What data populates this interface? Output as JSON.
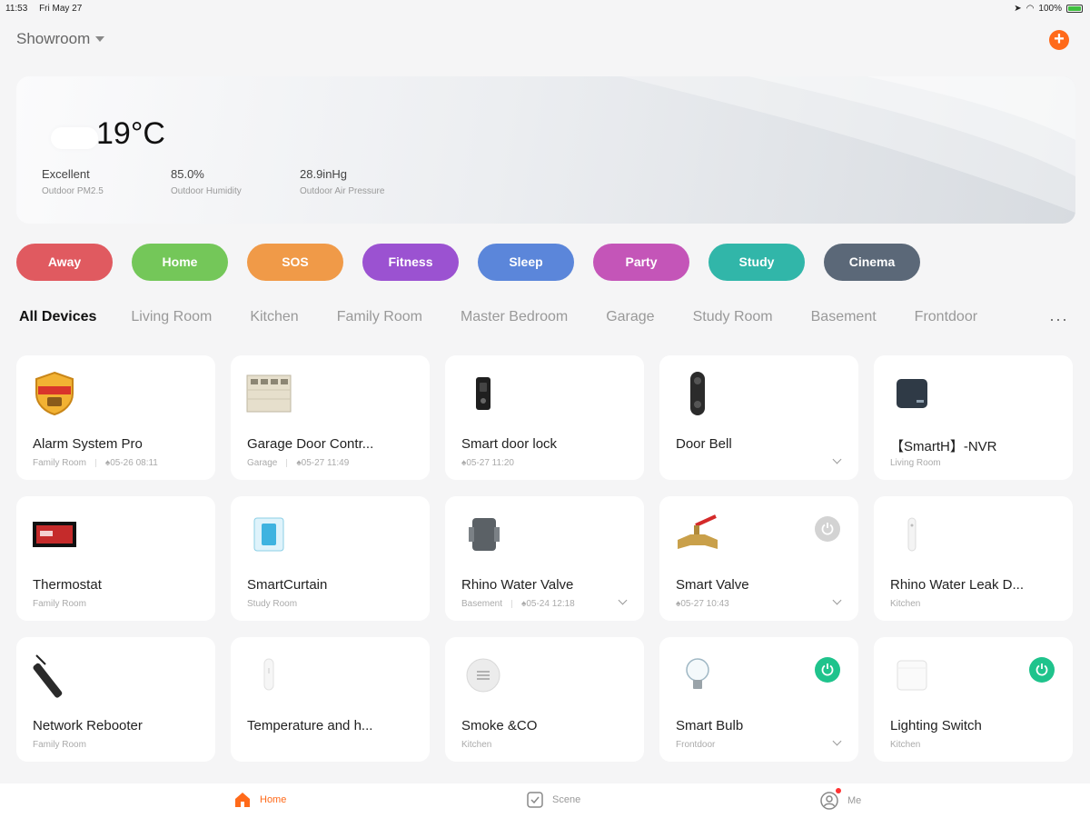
{
  "status_bar": {
    "time": "11:53",
    "date": "Fri May 27",
    "battery": "100%"
  },
  "header": {
    "home_name": "Showroom"
  },
  "weather": {
    "temperature": "19°C",
    "stats": [
      {
        "value": "Excellent",
        "label": "Outdoor PM2.5"
      },
      {
        "value": "85.0%",
        "label": "Outdoor Humidity"
      },
      {
        "value": "28.9inHg",
        "label": "Outdoor Air Pressure"
      }
    ]
  },
  "scenes": [
    {
      "label": "Away",
      "color": "#e05a60"
    },
    {
      "label": "Home",
      "color": "#74c759"
    },
    {
      "label": "SOS",
      "color": "#f09a48"
    },
    {
      "label": "Fitness",
      "color": "#9b52d1"
    },
    {
      "label": "Sleep",
      "color": "#5b86da"
    },
    {
      "label": "Party",
      "color": "#c455b8"
    },
    {
      "label": "Study",
      "color": "#31b6a9"
    },
    {
      "label": "Cinema",
      "color": "#5b6878"
    }
  ],
  "rooms": [
    "All Devices",
    "Living Room",
    "Kitchen",
    "Family Room",
    "Master Bedroom",
    "Garage",
    "Study Room",
    "Basement",
    "Frontdoor"
  ],
  "devices": [
    {
      "name": "Alarm System Pro",
      "room": "Family Room",
      "time": "05-26 08:11",
      "icon": "alarm-system-icon"
    },
    {
      "name": "Garage Door Contr...",
      "room": "Garage",
      "time": "05-27 11:49",
      "icon": "garage-door-icon"
    },
    {
      "name": "Smart door lock",
      "room": "",
      "time": "05-27 11:20",
      "icon": "door-lock-icon"
    },
    {
      "name": "Door Bell",
      "room": "",
      "time": "",
      "icon": "doorbell-icon"
    },
    {
      "name": "【SmartH】-NVR",
      "room": "Living Room",
      "time": "",
      "icon": "nvr-icon"
    },
    {
      "name": "Thermostat",
      "room": "Family Room",
      "time": "",
      "icon": "thermostat-icon"
    },
    {
      "name": "SmartCurtain",
      "room": "Study Room",
      "time": "",
      "icon": "curtain-icon"
    },
    {
      "name": "Rhino Water Valve",
      "room": "Basement",
      "time": "05-24 12:18",
      "icon": "water-valve-icon"
    },
    {
      "name": "Smart Valve",
      "room": "",
      "time": "05-27 10:43",
      "icon": "valve-icon"
    },
    {
      "name": "Rhino Water Leak D...",
      "room": "Kitchen",
      "time": "",
      "icon": "leak-sensor-icon"
    },
    {
      "name": "Network Rebooter",
      "room": "Family Room",
      "time": "",
      "icon": "power-strip-icon"
    },
    {
      "name": "Temperature and h...",
      "room": "",
      "time": "",
      "icon": "temp-sensor-icon"
    },
    {
      "name": "Smoke &CO",
      "room": "Kitchen",
      "time": "",
      "icon": "smoke-detector-icon"
    },
    {
      "name": "Smart Bulb",
      "room": "Frontdoor",
      "time": "",
      "icon": "bulb-icon"
    },
    {
      "name": "Lighting Switch",
      "room": "Kitchen",
      "time": "",
      "icon": "light-switch-icon"
    }
  ],
  "bottom_nav": [
    {
      "label": "Home",
      "icon": "home-icon"
    },
    {
      "label": "Scene",
      "icon": "scene-icon"
    },
    {
      "label": "Me",
      "icon": "profile-icon"
    }
  ],
  "colors": {
    "accent": "#ff6a1a",
    "power_on": "#1fc38c",
    "power_off": "#d3d3d3"
  }
}
